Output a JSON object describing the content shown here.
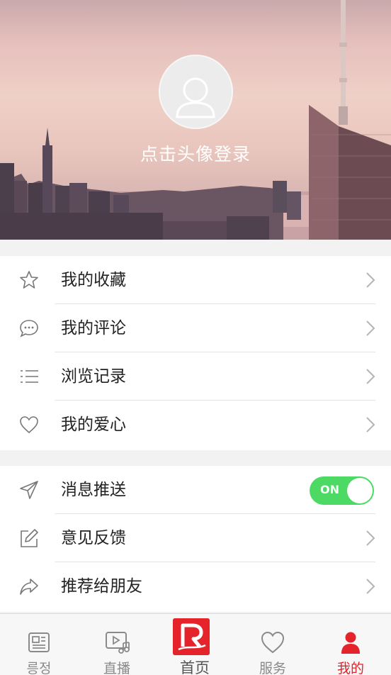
{
  "header": {
    "login_prompt": "点击头像登录"
  },
  "menu_section_1": {
    "items": [
      {
        "label": "我的收藏",
        "icon": "star-icon"
      },
      {
        "label": "我的评论",
        "icon": "comment-icon"
      },
      {
        "label": "浏览记录",
        "icon": "list-icon"
      },
      {
        "label": "我的爱心",
        "icon": "heart-icon"
      }
    ]
  },
  "menu_section_2": {
    "push": {
      "label": "消息推送",
      "icon": "send-icon",
      "toggle_label": "ON",
      "toggle_on": true
    },
    "items": [
      {
        "label": "意见反馈",
        "icon": "edit-icon"
      },
      {
        "label": "推荐给朋友",
        "icon": "share-icon"
      }
    ]
  },
  "tabbar": {
    "tabs": [
      {
        "label": "릉정",
        "icon": "newspaper-icon"
      },
      {
        "label": "直播",
        "icon": "live-video-icon"
      },
      {
        "label": "首页",
        "icon": "home-logo"
      },
      {
        "label": "服务",
        "icon": "heart-outline-icon"
      },
      {
        "label": "我的",
        "icon": "user-icon",
        "active": true
      }
    ],
    "colors": {
      "active": "#e4232b",
      "inactive": "#8a8a8a"
    }
  },
  "colors": {
    "toggle_on": "#4cd964",
    "brand_red": "#e4232b"
  }
}
